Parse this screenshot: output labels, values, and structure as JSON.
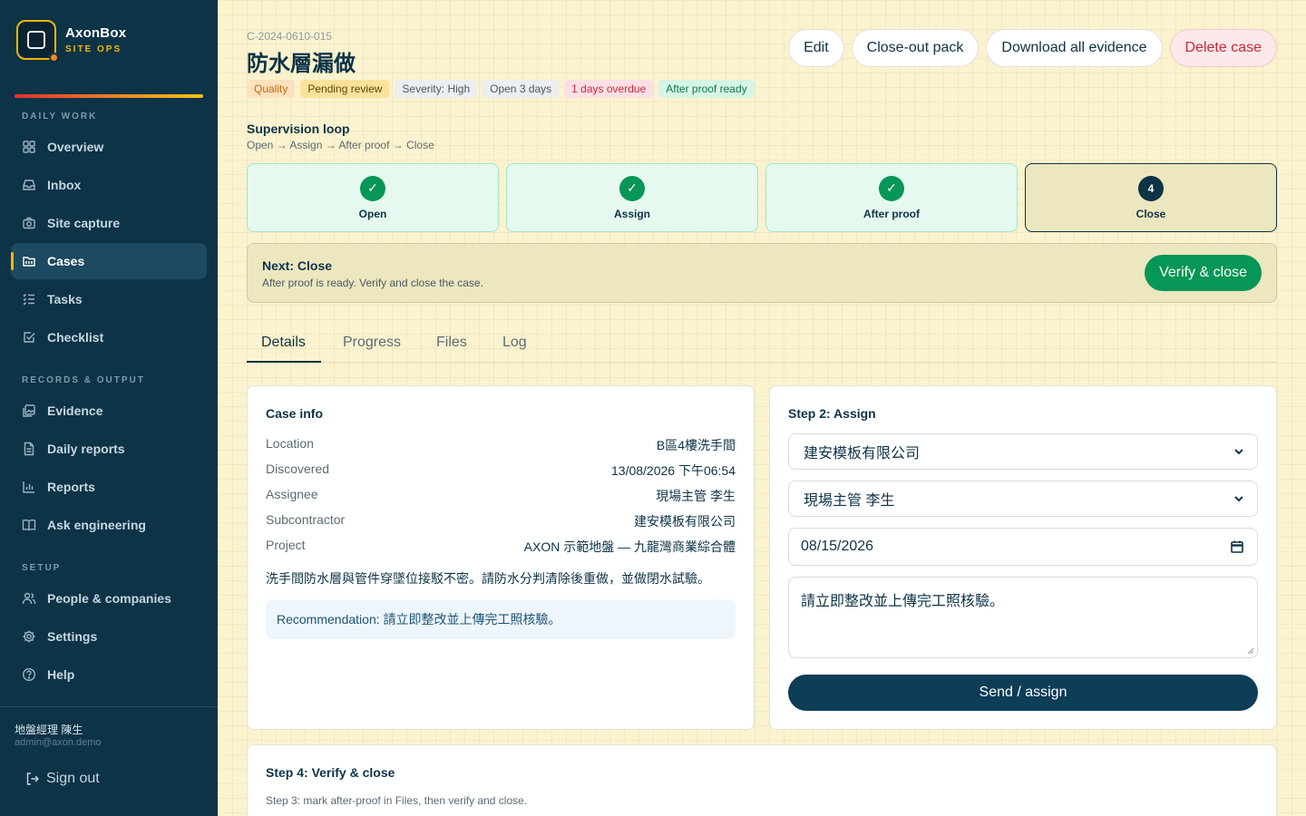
{
  "brand": {
    "name": "AxonBox",
    "sub": "SITE OPS"
  },
  "sidebar": {
    "sections": {
      "daily": "DAILY WORK",
      "records": "RECORDS & OUTPUT",
      "setup": "SETUP"
    },
    "items": [
      {
        "label": "Overview",
        "icon": "grid-icon"
      },
      {
        "label": "Inbox",
        "icon": "inbox-icon"
      },
      {
        "label": "Site capture",
        "icon": "camera-icon"
      },
      {
        "label": "Cases",
        "icon": "folder-icon",
        "active": true
      },
      {
        "label": "Tasks",
        "icon": "task-list-icon"
      },
      {
        "label": "Checklist",
        "icon": "checkbox-icon"
      },
      {
        "label": "Evidence",
        "icon": "image-icon"
      },
      {
        "label": "Daily reports",
        "icon": "document-icon"
      },
      {
        "label": "Reports",
        "icon": "bar-chart-icon"
      },
      {
        "label": "Ask engineering",
        "icon": "book-icon"
      },
      {
        "label": "People & companies",
        "icon": "people-icon"
      },
      {
        "label": "Settings",
        "icon": "gear-icon"
      },
      {
        "label": "Help",
        "icon": "help-icon"
      }
    ],
    "user": {
      "name": "地盤經理 陳生",
      "email": "admin@axon.demo"
    },
    "signout": "Sign out"
  },
  "header": {
    "case_id": "C-2024-0610-015",
    "title": "防水層漏做",
    "actions": {
      "edit": "Edit",
      "closeout": "Close-out pack",
      "download": "Download all evidence",
      "delete": "Delete case"
    },
    "badges": {
      "quality": "Quality",
      "pending": "Pending review",
      "severity": "Severity: High",
      "open": "Open 3 days",
      "overdue": "1 days overdue",
      "ready": "After proof ready"
    }
  },
  "loop": {
    "title": "Supervision loop",
    "subtitle": "Open → Assign → After proof → Close",
    "steps": [
      {
        "label": "Open",
        "mark": "✓",
        "done": true
      },
      {
        "label": "Assign",
        "mark": "✓",
        "done": true
      },
      {
        "label": "After proof",
        "mark": "✓",
        "done": true
      },
      {
        "label": "Close",
        "mark": "4",
        "done": false
      }
    ]
  },
  "next": {
    "title": "Next: Close",
    "desc": "After proof is ready. Verify and close the case.",
    "button": "Verify & close"
  },
  "tabs": [
    "Details",
    "Progress",
    "Files",
    "Log"
  ],
  "case_info": {
    "title": "Case info",
    "rows": [
      {
        "k": "Location",
        "v": "B區4樓洗手間"
      },
      {
        "k": "Discovered",
        "v": "13/08/2026 下午06:54"
      },
      {
        "k": "Assignee",
        "v": "現場主管 李生"
      },
      {
        "k": "Subcontractor",
        "v": "建安模板有限公司"
      },
      {
        "k": "Project",
        "v": "AXON 示範地盤 — 九龍灣商業綜合體"
      }
    ],
    "description": "洗手間防水層與管件穿墜位接駁不密。請防水分判清除後重做，並做閉水試驗。",
    "recommendation": "Recommendation: 請立即整改並上傳完工照核驗。"
  },
  "assign": {
    "title": "Step 2: Assign",
    "company": "建安模板有限公司",
    "person": "現場主管 李生",
    "due_date": "08/15/2026",
    "note": "請立即整改並上傳完工照核驗。",
    "button": "Send / assign"
  },
  "verify": {
    "title": "Step 4: Verify & close",
    "desc": "Step 3: mark after-proof in Files, then verify and close."
  }
}
